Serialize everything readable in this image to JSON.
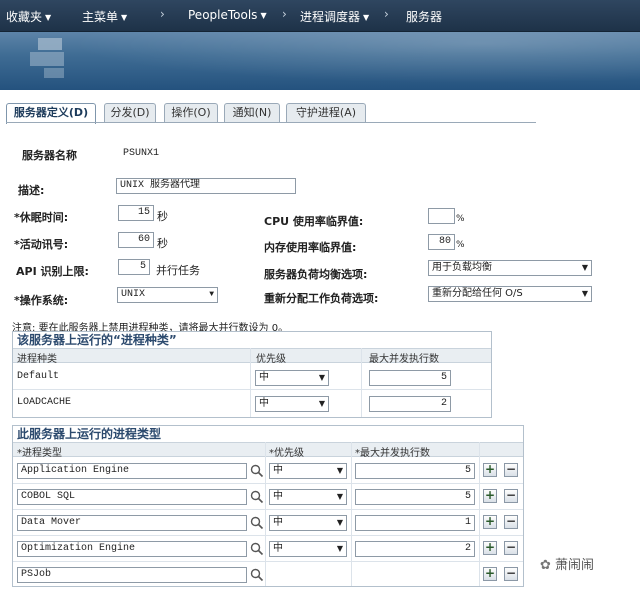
{
  "nav": {
    "favorites": "收藏夹",
    "main_menu": "主菜单",
    "peopletools": "PeopleTools",
    "process_scheduler": "进程调度器",
    "server": "服务器"
  },
  "tabs": [
    {
      "label": "服务器定义(D)",
      "active": true
    },
    {
      "label": "分发(D)"
    },
    {
      "label": "操作(O)"
    },
    {
      "label": "通知(N)"
    },
    {
      "label": "守护进程(A)"
    }
  ],
  "form": {
    "server_name_label": "服务器名称",
    "server_name_value": "PSUNX1",
    "description_label": "描述:",
    "description_value": "UNIX 服务器代理",
    "sleep_label": "*休眠时间:",
    "sleep_value": "15",
    "sleep_unit": "秒",
    "heartbeat_label": "*活动讯号:",
    "heartbeat_value": "60",
    "heartbeat_unit": "秒",
    "api_label": "API 识别上限:",
    "api_value": "5",
    "api_unit": "并行任务",
    "os_label": "*操作系统:",
    "os_value": "UNIX",
    "cpu_label": "CPU 使用率临界值:",
    "cpu_value": "",
    "cpu_unit": "%",
    "mem_label": "内存使用率临界值:",
    "mem_value": "80",
    "mem_unit": "%",
    "lb_label": "服务器负荷均衡选项:",
    "lb_value": "用于负载均衡",
    "redist_label": "重新分配工作负荷选项:",
    "redist_value": "重新分配给任何 O/S"
  },
  "note": "注意: 要在此服务器上禁用进程种类，请将最大并行数设为 0。",
  "categories_grid": {
    "title": "该服务器上运行的“进程种类”",
    "headers": [
      "进程种类",
      "优先级",
      "最大并发执行数"
    ],
    "rows": [
      {
        "name": "Default",
        "priority": "中",
        "max": "5"
      },
      {
        "name": "LOADCACHE",
        "priority": "中",
        "max": "2"
      }
    ]
  },
  "types_grid": {
    "title": "此服务器上运行的进程类型",
    "headers": [
      "*进程类型",
      "*优先级",
      "*最大并发执行数"
    ],
    "rows": [
      {
        "name": "Application Engine",
        "priority": "中",
        "max": "5"
      },
      {
        "name": "COBOL SQL",
        "priority": "中",
        "max": "5"
      },
      {
        "name": "Data Mover",
        "priority": "中",
        "max": "1"
      },
      {
        "name": "Optimization Engine",
        "priority": "中",
        "max": "2"
      },
      {
        "name": "PSJob",
        "priority": "",
        "max": ""
      }
    ]
  },
  "icons": {
    "dropdown": "chevron-down-icon",
    "lookup": "search-icon",
    "add": "plus-icon",
    "remove": "minus-icon"
  },
  "watermark": "萧闹闹",
  "colors": {
    "nav_bg": "#2f4660",
    "header_bg": "#3f6c94",
    "section_title": "#2c4a6e"
  }
}
